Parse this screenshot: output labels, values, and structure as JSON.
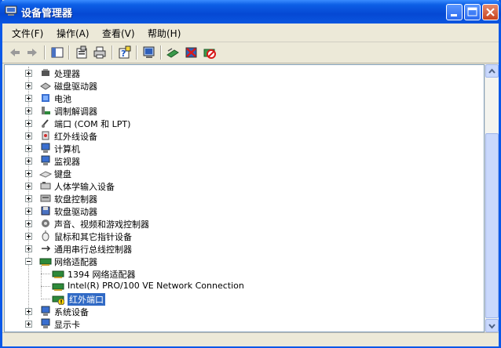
{
  "window": {
    "title": "设备管理器"
  },
  "menu": [
    "文件(F)",
    "操作(A)",
    "查看(V)",
    "帮助(H)"
  ],
  "toolbar": {
    "buttons": [
      "back-icon",
      "forward-icon",
      "console-tree-icon",
      "properties-icon",
      "print-icon",
      "help-icon",
      "scan-hardware-icon",
      "update-driver-icon",
      "uninstall-icon",
      "disable-icon"
    ]
  },
  "tree": [
    {
      "label": "处理器",
      "icon": "processor-icon",
      "expander": "plus"
    },
    {
      "label": "磁盘驱动器",
      "icon": "disk-drive-icon",
      "expander": "plus"
    },
    {
      "label": "电池",
      "icon": "battery-icon",
      "expander": "plus"
    },
    {
      "label": "调制解调器",
      "icon": "modem-icon",
      "expander": "plus"
    },
    {
      "label": "端口 (COM 和 LPT)",
      "icon": "port-icon",
      "expander": "plus"
    },
    {
      "label": "红外线设备",
      "icon": "infrared-icon",
      "expander": "plus"
    },
    {
      "label": "计算机",
      "icon": "computer-icon",
      "expander": "plus"
    },
    {
      "label": "监视器",
      "icon": "monitor-icon",
      "expander": "plus"
    },
    {
      "label": "键盘",
      "icon": "keyboard-icon",
      "expander": "plus"
    },
    {
      "label": "人体学输入设备",
      "icon": "hid-icon",
      "expander": "plus"
    },
    {
      "label": "软盘控制器",
      "icon": "floppy-controller-icon",
      "expander": "plus"
    },
    {
      "label": "软盘驱动器",
      "icon": "floppy-drive-icon",
      "expander": "plus"
    },
    {
      "label": "声音、视频和游戏控制器",
      "icon": "sound-icon",
      "expander": "plus"
    },
    {
      "label": "鼠标和其它指针设备",
      "icon": "mouse-icon",
      "expander": "plus"
    },
    {
      "label": "通用串行总线控制器",
      "icon": "usb-icon",
      "expander": "plus"
    },
    {
      "label": "网络适配器",
      "icon": "network-adapter-icon",
      "expander": "minus"
    },
    {
      "label": "1394 网络适配器",
      "icon": "network-adapter-icon",
      "child": true
    },
    {
      "label": "Intel(R) PRO/100 VE Network Connection",
      "icon": "network-adapter-icon",
      "child": true
    },
    {
      "label": "红外端口",
      "icon": "network-adapter-warning-icon",
      "child": true,
      "selected": true
    },
    {
      "label": "系统设备",
      "icon": "system-device-icon",
      "expander": "plus"
    },
    {
      "label": "显示卡",
      "icon": "display-adapter-icon",
      "expander": "plus"
    }
  ],
  "colors": {
    "title_bar": "#0a58e8",
    "selection": "#316ac5"
  }
}
